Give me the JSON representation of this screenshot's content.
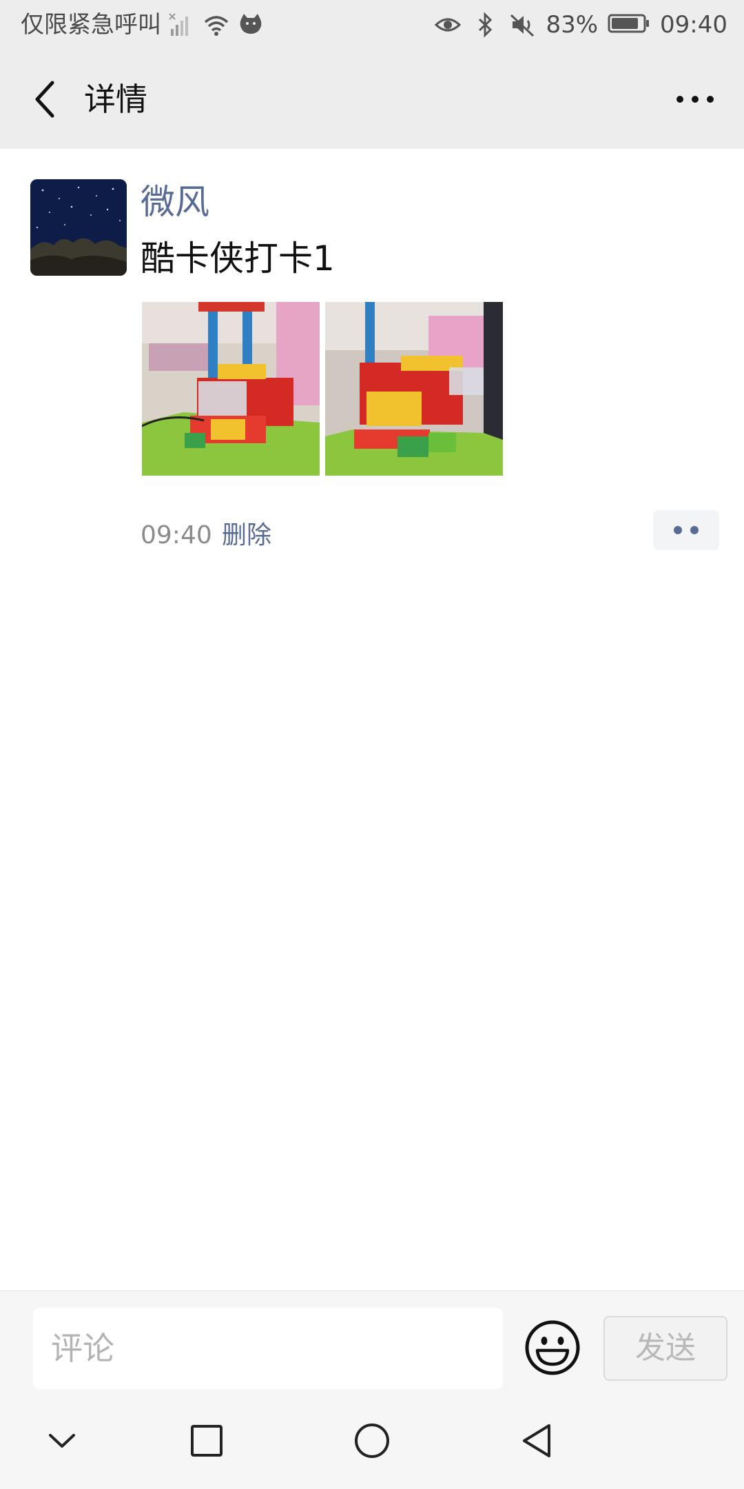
{
  "status_bar": {
    "carrier_text": "仅限紧急呼叫",
    "battery": "83%",
    "time": "09:40",
    "icons": [
      "no-signal-icon",
      "wifi-icon",
      "cat-icon",
      "eye-icon",
      "bluetooth-icon",
      "mute-icon",
      "battery-icon"
    ]
  },
  "header": {
    "title": "详情",
    "back_icon": "back-arrow-icon",
    "more_icon": "more-icon"
  },
  "post": {
    "author": "微风",
    "text": "酷卡侠打卡1",
    "photos": [
      "lego-photo-1",
      "lego-photo-2"
    ],
    "time": "09:40",
    "delete_label": "删除"
  },
  "comment_bar": {
    "placeholder": "评论",
    "send_label": "发送",
    "emoji_icon": "emoji-icon"
  },
  "nav": [
    "chevron-down-icon",
    "square-icon",
    "circle-icon",
    "triangle-back-icon"
  ],
  "colors": {
    "link": "#576b95",
    "bar_bg": "#ededed",
    "muted_text": "#8b8b8b"
  }
}
